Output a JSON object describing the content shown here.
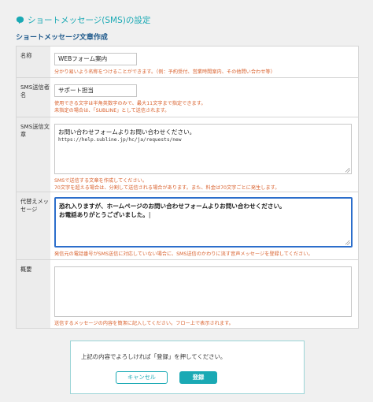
{
  "header": {
    "title": "ショートメッセージ(SMS)の設定",
    "icon": "speech-bubble-icon",
    "accent": "#1aa9b4"
  },
  "section_title": "ショートメッセージ文章作成",
  "fields": {
    "name": {
      "label": "名称",
      "value": "WEBフォーム案内",
      "hint": "分かり易いよう名称をつけることができます。（例：予約受付、営業時間案内、その他問い合わせ等）"
    },
    "sender": {
      "label": "SMS送信者名",
      "value": "サポート担当",
      "hint1": "使用できる文字は半角英数字のみで、最大11文字まで指定できます。",
      "hint2": "未指定の場合は、「SUBLINE」として送信されます。"
    },
    "body": {
      "label": "SMS送信文章",
      "line1": "お問い合わせフォームよりお問い合わせください。",
      "line2": "https://help.subline.jp/hc/ja/requests/new",
      "hint1": "SMSで送信する文章を作成してください。",
      "hint2": "70文字を超える場合は、分割して送信される場合があります。また、料金は70文字ごとに発生します。"
    },
    "alt": {
      "label": "代替えメッセージ",
      "line1": "恐れ入りますが、ホームページのお問い合わせフォームよりお問い合わせください。",
      "line2": "お電話ありがとうございました。",
      "hint": "発信元の電話番号がSMS送信に対応していない場合に、SMS送信のかわりに流す音声メッセージを登録してください。"
    },
    "summary": {
      "label": "概要",
      "value": "",
      "hint": "送信するメッセージの内容を簡潔に記入してください。フロー上で表示されます。"
    }
  },
  "confirm": {
    "message": "上記の内容でよろしければ「登録」を押してください。",
    "cancel_label": "キャンセル",
    "register_label": "登録"
  }
}
